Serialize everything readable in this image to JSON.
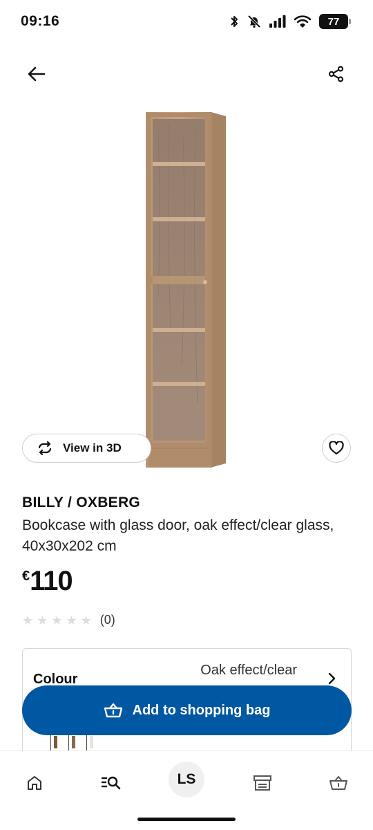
{
  "status_bar": {
    "time": "09:16",
    "battery": "77",
    "icons": [
      "bluetooth-icon",
      "muted-bell-icon",
      "signal-icon",
      "wifi-icon",
      "battery-icon"
    ]
  },
  "nav": {
    "back_icon": "arrow-left-icon",
    "share_icon": "share-icon"
  },
  "product": {
    "image_alt": "BILLY / OXBERG bookcase",
    "view_3d_label": "View in 3D",
    "name": "BILLY / OXBERG",
    "description": "Bookcase with glass door, oak effect/clear glass, 40x30x202 cm",
    "price_currency": "€",
    "price_value": "110",
    "rating_stars": 0,
    "rating_max": 5,
    "rating_count": "(0)"
  },
  "colour": {
    "label": "Colour",
    "value": "Oak effect/clear",
    "swatch_colors": [
      "#7b5a3c",
      "#8a6a48",
      "#e8e4de"
    ]
  },
  "actions": {
    "add_to_bag_label": "Add to shopping bag"
  },
  "bottom_nav": {
    "avatar_initials": "LS",
    "items": [
      "home-icon",
      "search-list-icon",
      "avatar",
      "store-icon",
      "shopping-bag-icon"
    ]
  },
  "colors": {
    "primary_blue": "#0058a3",
    "star_empty": "#dcdcdc"
  }
}
